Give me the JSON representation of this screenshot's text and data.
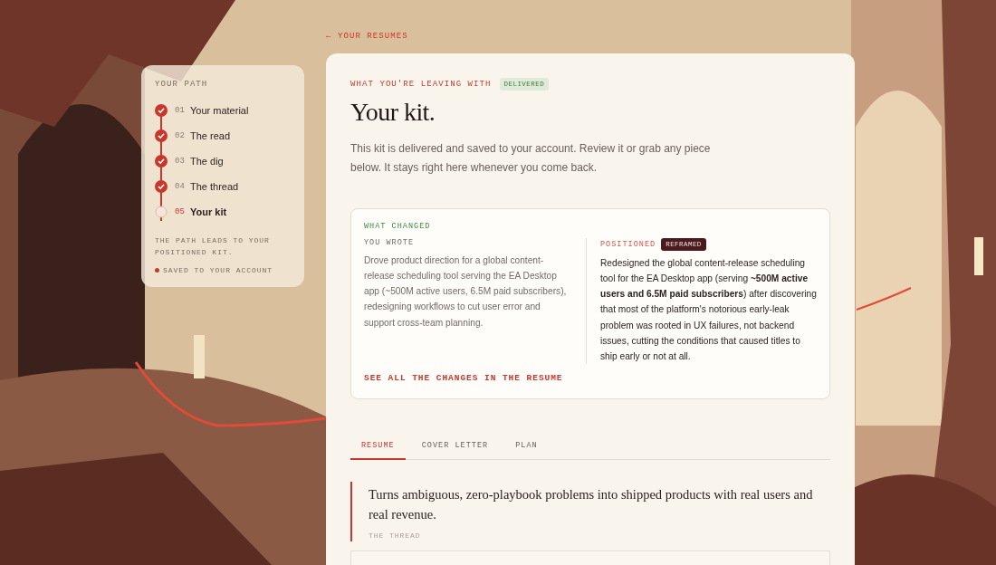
{
  "back_link": "← YOUR RESUMES",
  "path_panel": {
    "title": "YOUR PATH",
    "steps": [
      {
        "number": "01",
        "label": "Your material",
        "checked": true,
        "selected": false
      },
      {
        "number": "02",
        "label": "The read",
        "checked": true,
        "selected": false
      },
      {
        "number": "03",
        "label": "The dig",
        "checked": true,
        "selected": false
      },
      {
        "number": "04",
        "label": "The thread",
        "checked": true,
        "selected": false
      },
      {
        "number": "05",
        "label": "Your kit",
        "checked": false,
        "selected": true
      }
    ],
    "note": "THE PATH LEADS TO YOUR POSITIONED KIT.",
    "saved": "SAVED TO YOUR ACCOUNT"
  },
  "kit": {
    "eyebrow": "WHAT YOU'RE LEAVING WITH",
    "badge": "DELIVERED",
    "title": "Your kit.",
    "intro": "This kit is delivered and saved to your account. Review it or grab any piece below. It stays right here whenever you come back.",
    "changes": {
      "heading": "WHAT CHANGED",
      "original_label": "YOU WROTE",
      "original_text": "Drove product direction for a global content-release scheduling tool serving the EA Desktop app (~500M active users, 6.5M paid subscribers), redesigning workflows to cut user error and support cross-team planning.",
      "positioned_label": "POSITIONED",
      "positioned_badge": "REFRAMED",
      "positioned_text": "Redesigned the global content-release scheduling tool for the EA Desktop app (serving **~500M active users and 6.5M paid subscribers**) after discovering that most of the platform's notorious early-leak problem was rooted in UX failures, not backend issues, cutting the conditions that caused titles to ship early or not at all.",
      "link": "SEE ALL THE CHANGES IN THE RESUME"
    },
    "tabs": [
      {
        "label": "RESUME",
        "selected": true
      },
      {
        "label": "COVER LETTER",
        "selected": false
      },
      {
        "label": "PLAN",
        "selected": false
      }
    ],
    "quote": {
      "text": "Turns ambiguous, zero-playbook problems into shipped products with real users and real revenue.",
      "caption": "THE THREAD"
    }
  }
}
